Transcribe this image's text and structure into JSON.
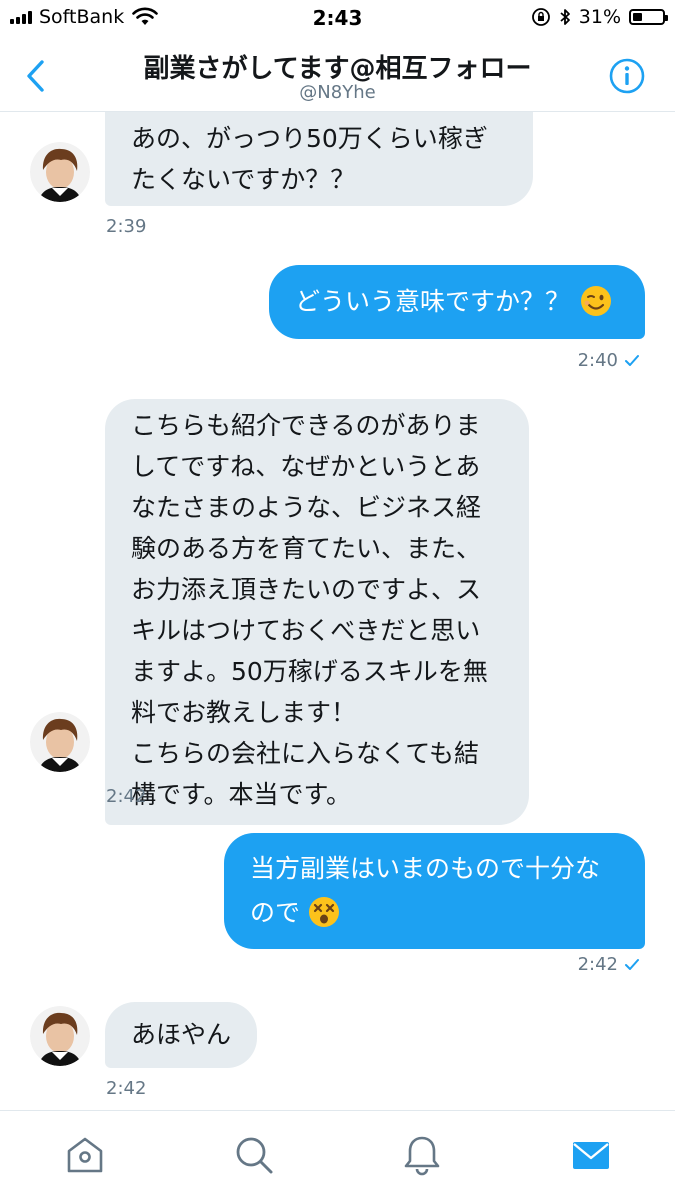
{
  "status_bar": {
    "carrier": "SoftBank",
    "time": "2:43",
    "battery": "31%"
  },
  "header": {
    "title": "副業さがしてます@相互フォロー",
    "handle": "@N8Yhe",
    "back_icon": "chevron-left-icon",
    "info_icon": "info-icon",
    "accent_color": "#1da1f2"
  },
  "messages": [
    {
      "direction": "in",
      "lines": [
        "あの、がっつり50万くらい稼ぎ",
        "たくないですか？？"
      ],
      "time": "2:39"
    },
    {
      "direction": "out",
      "text": "どういう意味ですか？？",
      "emoji": "winking-face",
      "time": "2:40"
    },
    {
      "direction": "in",
      "lines": [
        "こちらも紹介できるのがありま",
        "してですね、なぜかというとあ",
        "なたさまのような、ビジネス経",
        "験のある方を育てたい、また、",
        "お力添え頂きたいのですよ、ス",
        "キルはつけておくべきだと思い",
        "ますよ。50万稼げるスキルを無",
        "料でお教えします！",
        "こちらの会社に入らなくても結",
        "構です。本当です。"
      ],
      "time": "2:42"
    },
    {
      "direction": "out",
      "line1": "当方副業はいまのもので十分な",
      "line2": "ので",
      "emoji": "dizzy-face",
      "time": "2:42"
    },
    {
      "direction": "in",
      "lines": [
        "あほやん"
      ],
      "time": "2:42"
    }
  ],
  "tabs": [
    {
      "name": "home",
      "icon": "home-icon",
      "active": false
    },
    {
      "name": "search",
      "icon": "search-icon",
      "active": false
    },
    {
      "name": "notifications",
      "icon": "bell-icon",
      "active": false
    },
    {
      "name": "messages",
      "icon": "envelope-icon",
      "active": true
    }
  ]
}
